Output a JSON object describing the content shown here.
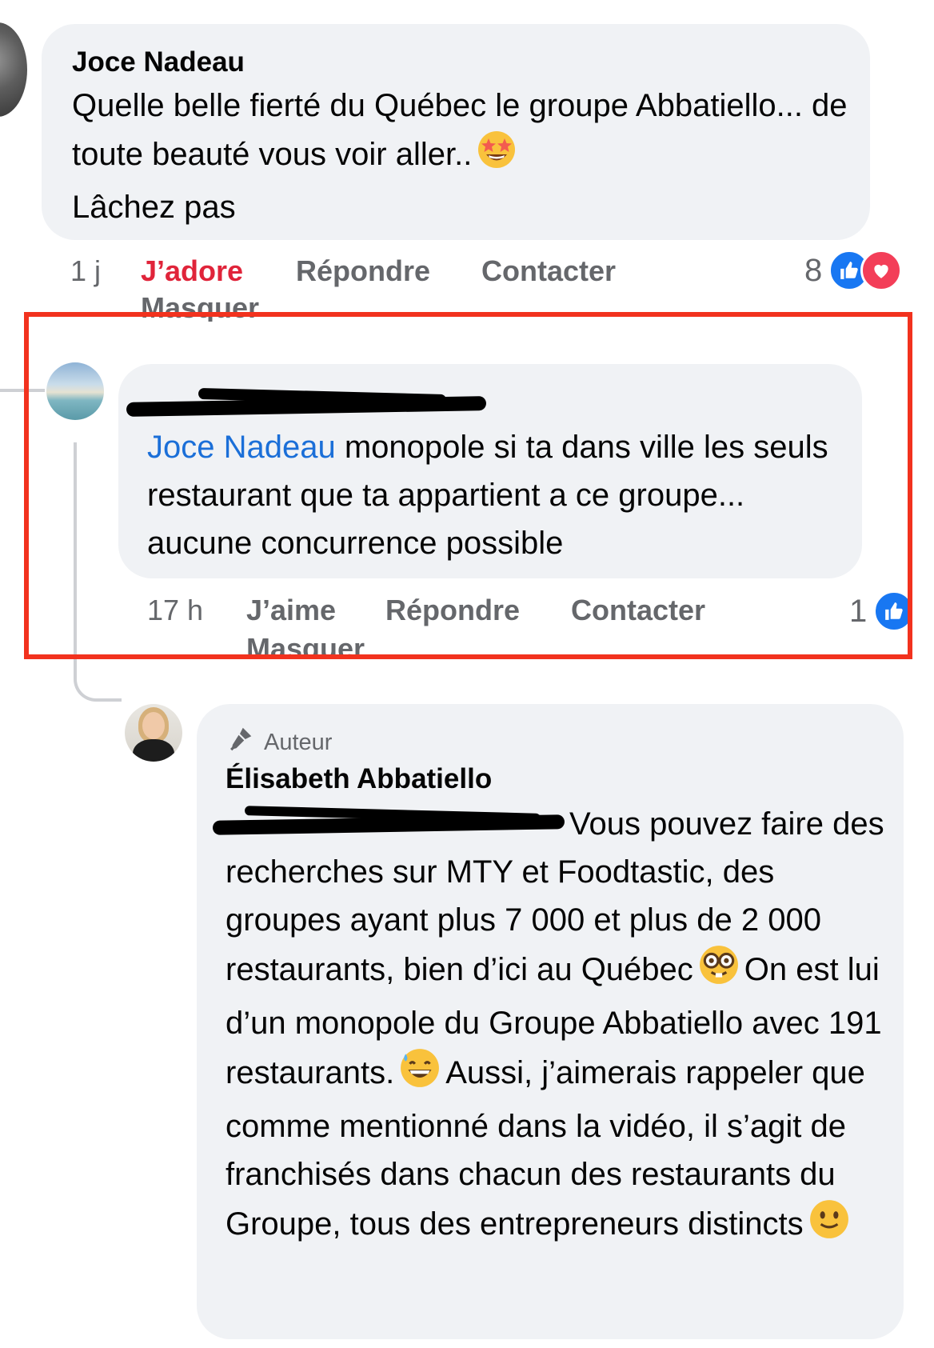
{
  "comments": [
    {
      "author": "Joce Nadeau",
      "text": "Quelle belle fierté du Québec le groupe Abbatiello... de toute beauté vous voir aller..",
      "text_after_emoji": "Lâchez pas",
      "emoji": "star-struck-emoji",
      "time": "1 j",
      "reaction_label": "J’adore",
      "reply_label": "Répondre",
      "contact_label": "Contacter",
      "hide_label": "Masquer",
      "reaction_count": "8",
      "reaction_icons": [
        "like-icon",
        "love-icon"
      ]
    },
    {
      "author_redacted": true,
      "mention": "Joce Nadeau",
      "text": " monopole si ta dans ville les seuls restaurant que ta appartient a ce groupe... aucune concurrence possible",
      "time": "17 h",
      "like_label": "J’aime",
      "reply_label": "Répondre",
      "contact_label": "Contacter",
      "hide_label": "Masquer",
      "reaction_count": "1",
      "reaction_icons": [
        "like-icon"
      ]
    },
    {
      "badge": "Auteur",
      "badge_icon": "microphone-icon",
      "author": "Élisabeth Abbatiello",
      "mention_redacted": true,
      "text_part1": "Vous pouvez faire des recherches sur MTY et Foodtastic, des groupes ayant plus 7 000 et plus de 2 000 restaurants, bien d’ici au Québec",
      "emoji1": "nerd-face-emoji",
      "text_part2": "On est lui d’un monopole du Groupe Abbatiello avec 191 restaurants.",
      "emoji2": "grinning-sweat-emoji",
      "text_part3": "Aussi, j’aimerais rappeler que comme mentionné dans la vidéo, il s’agit de franchisés dans chacun des restaurants du Groupe, tous des entrepreneurs distincts",
      "emoji3": "slightly-smiling-emoji"
    }
  ],
  "colors": {
    "bubble": "#f0f2f5",
    "mention": "#1b6fd8",
    "love_text": "#e0243a",
    "highlight_box": "#f2321e",
    "meta_text": "#65676b"
  }
}
